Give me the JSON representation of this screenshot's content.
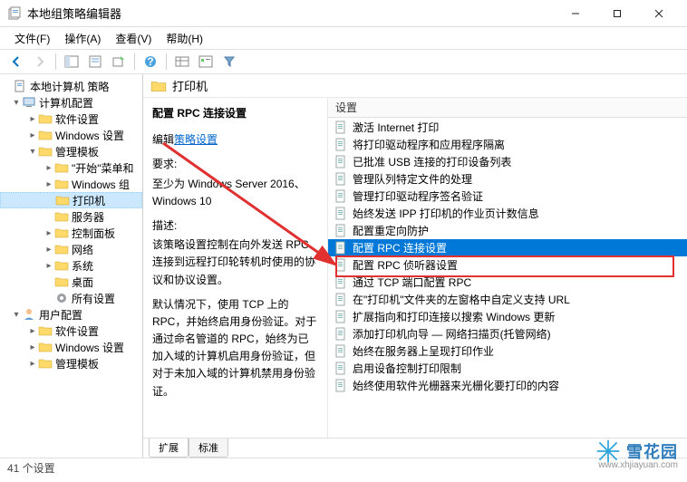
{
  "window": {
    "title": "本地组策略编辑器"
  },
  "menu": {
    "file": "文件(F)",
    "action": "操作(A)",
    "view": "查看(V)",
    "help": "帮助(H)"
  },
  "tree": {
    "root": "本地计算机 策略",
    "computer": "计算机配置",
    "software1": "软件设置",
    "winset1": "Windows 设置",
    "admintmpl": "管理模板",
    "startmenu": "\"开始\"菜单和",
    "wincomp": "Windows 组",
    "printers": "打印机",
    "servers": "服务器",
    "ctrlpanel": "控制面板",
    "network": "网络",
    "system": "系统",
    "desktop": "桌面",
    "allsettings": "所有设置",
    "user": "用户配置",
    "software2": "软件设置",
    "winset2": "Windows 设置",
    "admintmpl2": "管理模板"
  },
  "header": {
    "title": "打印机"
  },
  "info": {
    "title": "配置 RPC 连接设置",
    "editprefix": "编辑",
    "editlink": "策略设置",
    "reqlabel": "要求:",
    "reqtext": "至少为 Windows Server 2016、Windows 10",
    "desclabel": "描述:",
    "desc1": "该策略设置控制在向外发送 RPC 连接到远程打印轮转机时使用的协议和协议设置。",
    "desc2": "默认情况下，使用 TCP 上的 RPC，并始终启用身份验证。对于通过命名管道的 RPC，始终为已加入域的计算机启用身份验证，但对于未加入域的计算机禁用身份验证。"
  },
  "listheader": "设置",
  "items": [
    "激活 Internet 打印",
    "将打印驱动程序和应用程序隔离",
    "已批准 USB 连接的打印设备列表",
    "管理队列特定文件的处理",
    "管理打印驱动程序签名验证",
    "始终发送 IPP 打印机的作业页计数信息",
    "配置重定向防护",
    "配置 RPC 连接设置",
    "配置 RPC 侦听器设置",
    "通过 TCP 端口配置 RPC",
    "在\"打印机\"文件夹的左窗格中自定义支持 URL",
    "扩展指向和打印连接以搜索 Windows 更新",
    "添加打印机向导 — 网络扫描页(托管网络)",
    "始终在服务器上呈现打印作业",
    "启用设备控制打印限制",
    "始终使用软件光栅器来光栅化要打印的内容"
  ],
  "selectedIndex": 7,
  "tabs": {
    "ext": "扩展",
    "std": "标准"
  },
  "status": "41 个设置",
  "watermark": {
    "name": "雪花园",
    "url": "www.xhjiayuan.com"
  }
}
